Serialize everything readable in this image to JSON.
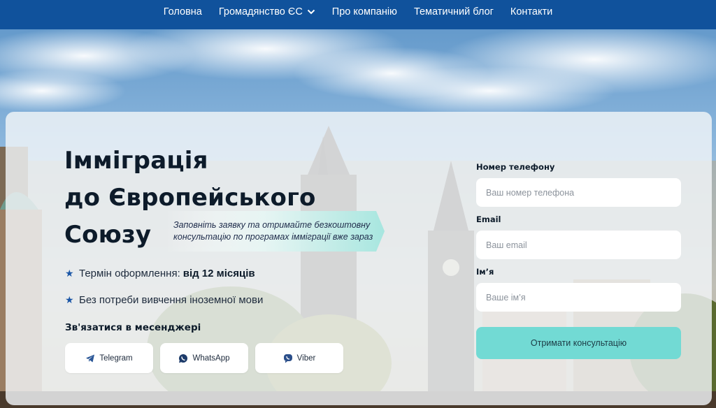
{
  "nav": {
    "items": [
      {
        "label": "Головна",
        "has_dropdown": false
      },
      {
        "label": "Громадянство ЄС",
        "has_dropdown": true
      },
      {
        "label": "Про компанію",
        "has_dropdown": false
      },
      {
        "label": "Тематичний блог",
        "has_dropdown": false
      },
      {
        "label": "Контакти",
        "has_dropdown": false
      }
    ]
  },
  "hero": {
    "title_lines": [
      "Імміграція",
      "до Європейського",
      "Союзу"
    ],
    "promo_text": "Заповніть заявку та отримайте безкоштовну консультацію по програмах імміграції вже зараз",
    "features": [
      {
        "icon": "star-icon",
        "text": "Термін оформлення:",
        "highlight": "від 12 місяців"
      },
      {
        "icon": "star-icon",
        "text": "Без потреби вивчення іноземної мови",
        "highlight": ""
      }
    ],
    "messenger_title": "Зв'язатися в месенджері",
    "messengers": [
      {
        "label": "Telegram",
        "icon": "telegram-icon"
      },
      {
        "label": "WhatsApp",
        "icon": "whatsapp-icon"
      },
      {
        "label": "Viber",
        "icon": "viber-icon"
      }
    ]
  },
  "form": {
    "phone": {
      "label": "Номер телефону",
      "placeholder": "Ваш номер телефона",
      "value": ""
    },
    "email": {
      "label": "Email",
      "placeholder": "Ваш email",
      "value": ""
    },
    "name": {
      "label": "Ім’я",
      "placeholder": "Ваше ім’я",
      "value": ""
    },
    "submit_label": "Отримати консультацію"
  },
  "colors": {
    "nav_bg": "#10529c",
    "accent_teal": "#72dad4",
    "star_blue": "#1a56a6",
    "title_dark": "#0d1b2a"
  }
}
